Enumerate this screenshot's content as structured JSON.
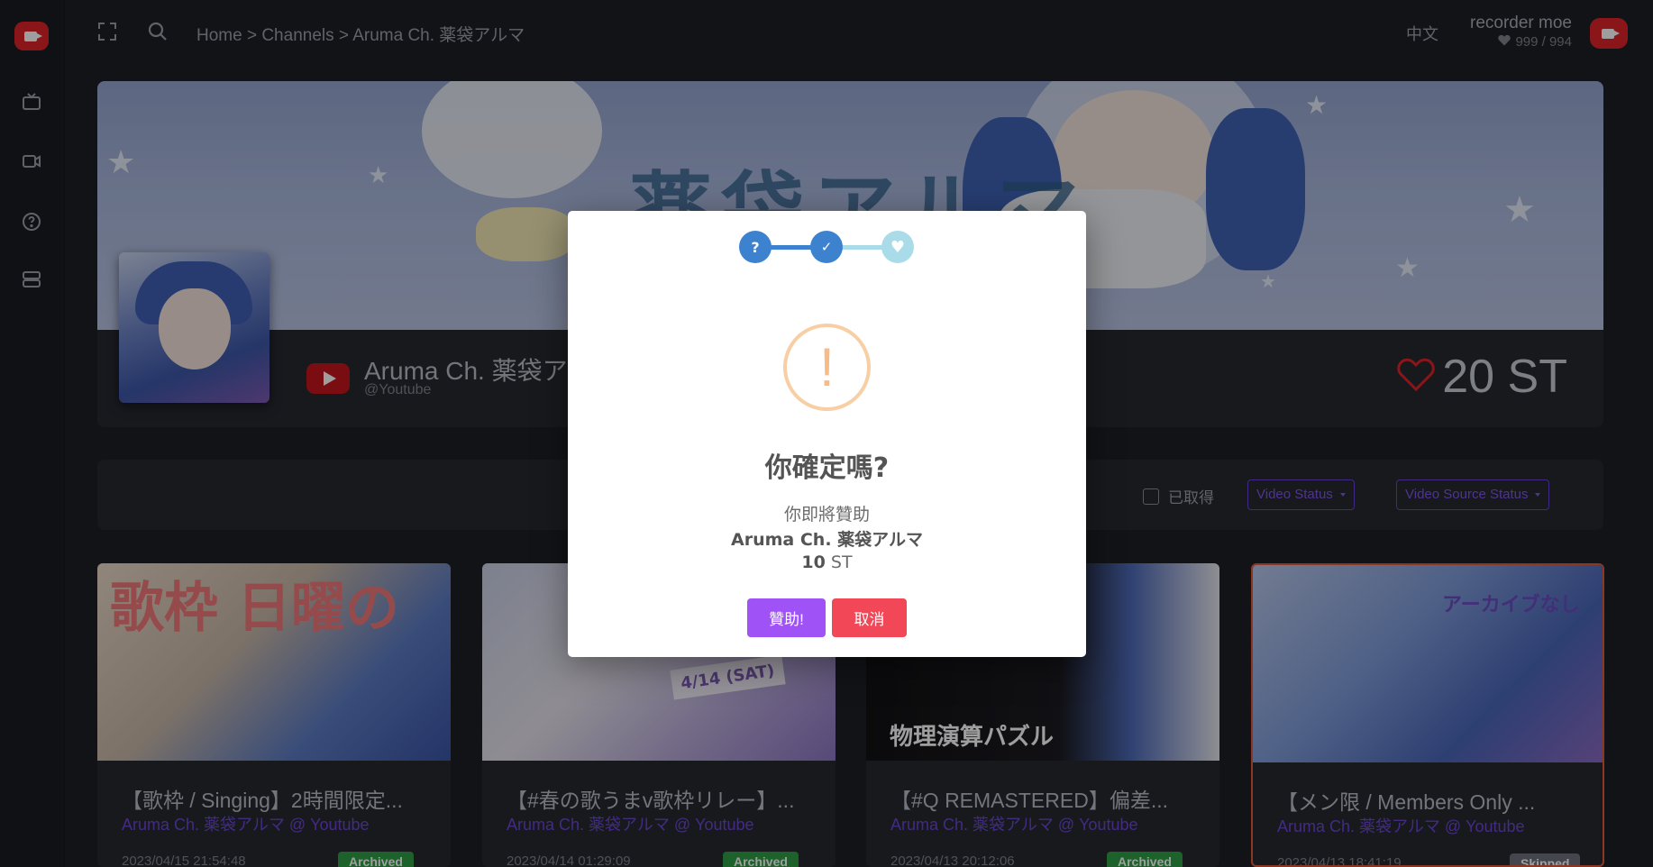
{
  "topbar": {
    "breadcrumb": "Home > Channels > Aruma Ch. 薬袋アルマ",
    "language": "中文",
    "user_name": "recorder moe",
    "user_hearts": "999 / 994"
  },
  "channel": {
    "banner_title": "薬袋アルマ",
    "name": "Aruma Ch. 薬袋アルマ",
    "handle": "@Youtube",
    "st_total": "20 ST"
  },
  "filters": {
    "obtained_label": "已取得",
    "video_status": "Video Status",
    "video_source_status": "Video Source Status"
  },
  "videos": [
    {
      "title": "【歌枠 / Singing】2時間限定...",
      "channel": "Aruma Ch. 薬袋アルマ @ Youtube",
      "date": "2023/04/15 21:54:48",
      "status": "Archived",
      "thumb_text": "歌枠 日曜の"
    },
    {
      "title": "【#春の歌うまv歌枠リレー】...",
      "channel": "Aruma Ch. 薬袋アルマ @ Youtube",
      "date": "2023/04/14 01:29:09",
      "status": "Archived",
      "thumb_text": "4/14 (SAT)"
    },
    {
      "title": "【#Q REMASTERED】偏差...",
      "channel": "Aruma Ch. 薬袋アルマ @ Youtube",
      "date": "2023/04/13 20:12:06",
      "status": "Archived",
      "thumb_text": "物理演算パズル"
    },
    {
      "title": "【メン限 / Members Only ...",
      "channel": "Aruma Ch. 薬袋アルマ @ Youtube",
      "date": "2023/04/13 18:41:19",
      "status": "Skipped",
      "thumb_text": "アーカイブなし"
    }
  ],
  "modal": {
    "step1_glyph": "?",
    "step2_glyph": "✓",
    "step3_glyph": "♥",
    "warning_glyph": "!",
    "title": "你確定嗎?",
    "intro": "你即將贊助",
    "channel_name": "Aruma Ch. 薬袋アルマ",
    "amount_value": "10",
    "amount_unit": "ST",
    "confirm_label": "贊助!",
    "cancel_label": "取消"
  },
  "colors": {
    "brand_red": "#e0242b",
    "accent_purple": "#9f52f5",
    "cancel_red": "#f24757",
    "archived_green": "#2f9e46",
    "skipped_gray": "#6c737c",
    "warning_orange": "#f8bb86",
    "step_blue": "#3d82cf",
    "step_light_blue": "#a9dbe9"
  }
}
